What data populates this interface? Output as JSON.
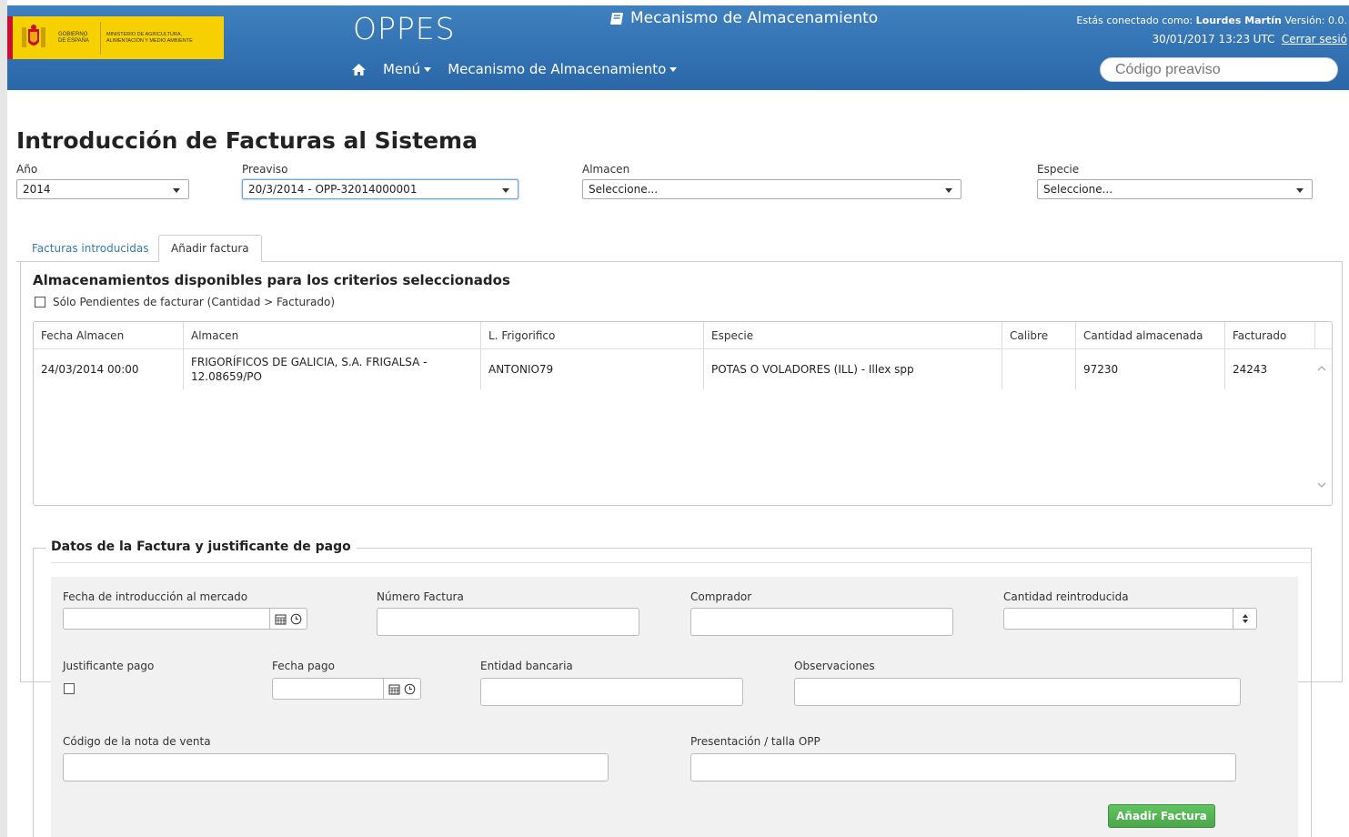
{
  "header": {
    "gov_text": "Gobierno de España",
    "ministry_text": "Ministerio de Agricultura, Alimentación y Medio Ambiente",
    "app_title": "OPPES",
    "module_title": "Mecanismo de Almacenamiento",
    "connected_prefix": "Estás conectado como:",
    "user_name": "Lourdes Martín",
    "version_prefix": "Versión: 0.0.",
    "timestamp": "30/01/2017 13:23",
    "timezone": "UTC",
    "logout_label": "Cerrar sesió",
    "nav": {
      "menu_label": "Menú",
      "module_label": "Mecanismo de Almacenamiento"
    },
    "search_placeholder": "Código preaviso"
  },
  "page_title": "Introducción de Facturas al Sistema",
  "filters": {
    "year": {
      "label": "Año",
      "value": "2014"
    },
    "preaviso": {
      "label": "Preaviso",
      "value": "20/3/2014 - OPP-32014000001"
    },
    "almacen": {
      "label": "Almacen",
      "value": "Seleccione..."
    },
    "especie": {
      "label": "Especie",
      "value": "Seleccione..."
    }
  },
  "tabs": [
    {
      "label": "Facturas introducidas",
      "active": false
    },
    {
      "label": "Añadir factura",
      "active": true
    }
  ],
  "storage_section": {
    "title": "Almacenamientos disponibles para los criterios seleccionados",
    "pending_only_label": "Sólo Pendientes de facturar (Cantidad > Facturado)",
    "columns": [
      "Fecha Almacen",
      "Almacen",
      "L. Frigorifico",
      "Especie",
      "Calibre",
      "Cantidad almacenada",
      "Facturado"
    ],
    "rows": [
      [
        "24/03/2014 00:00",
        "FRIGORÍFICOS DE GALICIA, S.A. FRIGALSA - 12.08659/PO",
        "ANTONIO79",
        "POTAS O VOLADORES (ILL) - Illex spp",
        "",
        "97230",
        "24243"
      ]
    ]
  },
  "invoice_form": {
    "legend": "Datos de la Factura y justificante de pago",
    "market_date_label": "Fecha de introducción al mercado",
    "invoice_number_label": "Número Factura",
    "buyer_label": "Comprador",
    "reintroduced_qty_label": "Cantidad reintroducida",
    "payment_proof_label": "Justificante pago",
    "payment_date_label": "Fecha pago",
    "bank_label": "Entidad bancaria",
    "observations_label": "Observaciones",
    "sale_note_code_label": "Código de la nota de venta",
    "presentation_label": "Presentación / talla OPP",
    "add_button_label": "Añadir Factura"
  },
  "colors": {
    "header_blue": "#2f6fb0",
    "gov_yellow": "#f6d000",
    "link_blue": "#337ab7",
    "success_green": "#5cb85c"
  }
}
